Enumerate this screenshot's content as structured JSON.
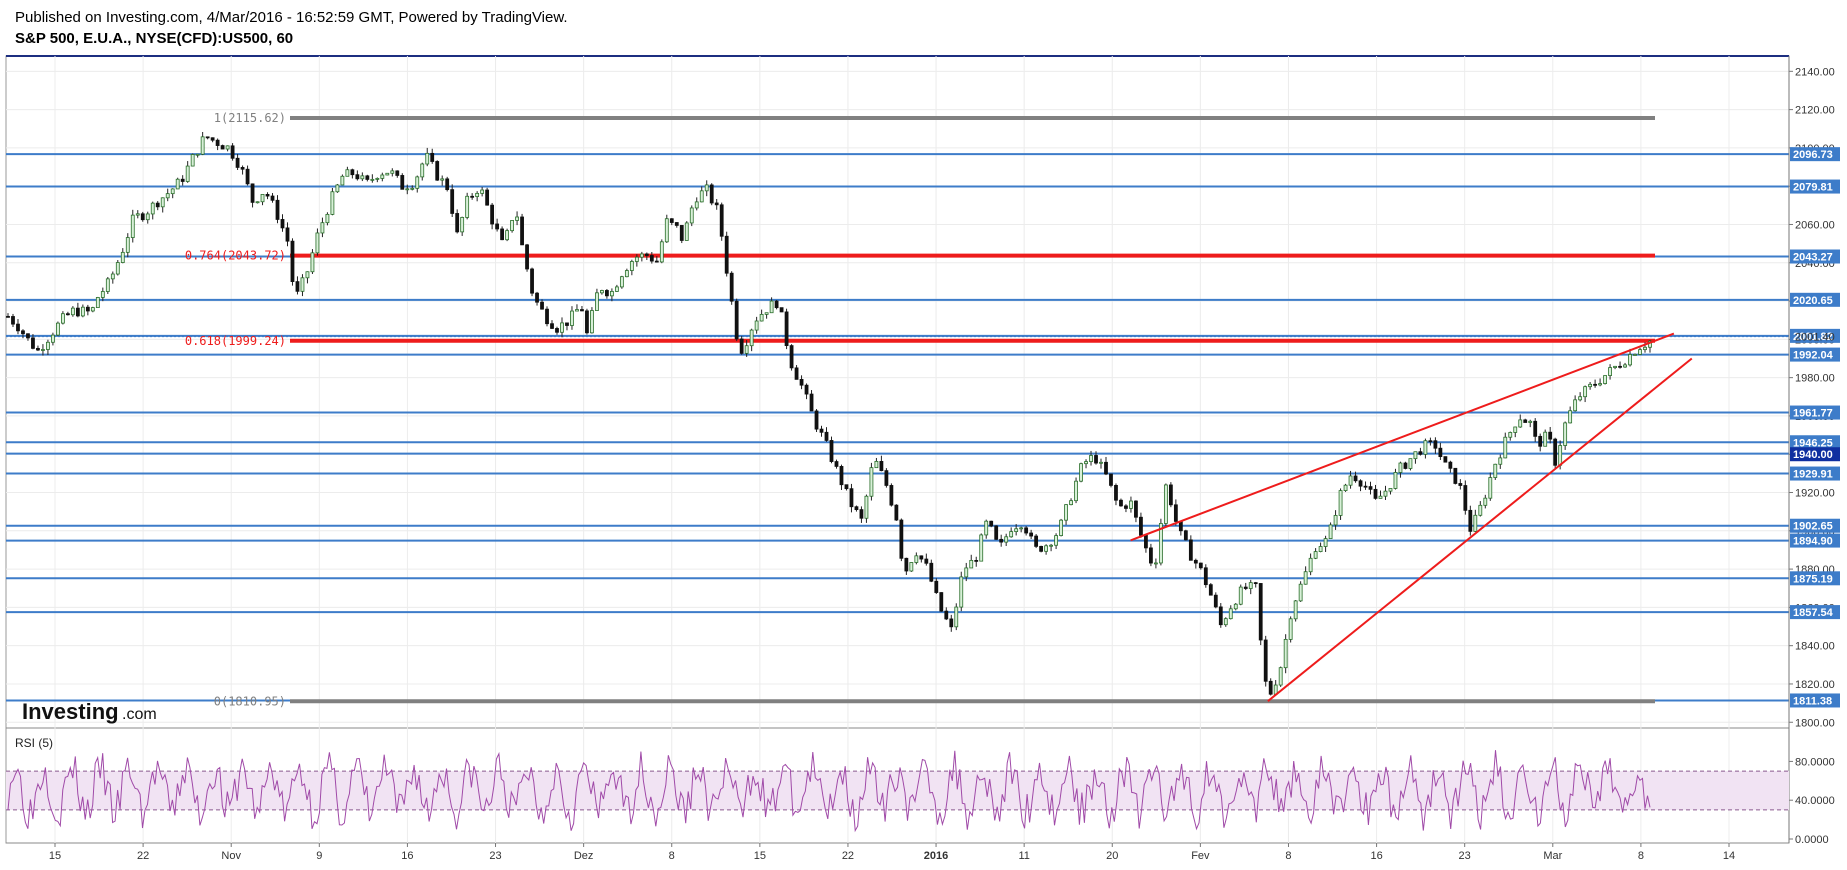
{
  "header": {
    "published": "Published on Investing.com, 4/Mar/2016 - 16:52:59 GMT, Powered by TradingView.",
    "symbol": "S&P 500, E.U.A., NYSE(CFD):US500, 60"
  },
  "logo": {
    "main": "Investing",
    "suffix": ".com"
  },
  "rsi_label": "RSI (5)",
  "chart_data": {
    "type": "candlestick",
    "price_axis": {
      "ylim": [
        1797,
        2148
      ],
      "ticks": [
        1800,
        1820,
        1840,
        1860,
        1880,
        1900,
        1920,
        1940,
        1960,
        1980,
        2000,
        2020,
        2040,
        2060,
        2080,
        2100,
        2120,
        2140
      ],
      "tick_labels": [
        "1800.00",
        "1820.00",
        "1840.00",
        "1860.00",
        "1880.00",
        "1900.00",
        "1920.00",
        "1940.00",
        "1960.00",
        "1980.00",
        "2000.00",
        "2020.00",
        "2040.00",
        "2060.00",
        "2080.00",
        "2100.00",
        "2120.00",
        "2140.00"
      ]
    },
    "x_axis": {
      "labels": [
        "15",
        "22",
        "Nov",
        "9",
        "16",
        "23",
        "Dez",
        "8",
        "15",
        "22",
        "2016",
        "11",
        "20",
        "Fev",
        "8",
        "16",
        "23",
        "Mar",
        "8",
        "14"
      ],
      "bold_labels": [
        "2016"
      ]
    },
    "horizontal_levels": [
      {
        "value": 2096.73,
        "label": "2096.73"
      },
      {
        "value": 2079.81,
        "label": "2079.81"
      },
      {
        "value": 2043.27,
        "label": "2043.27"
      },
      {
        "value": 2020.65,
        "label": "2020.65"
      },
      {
        "value": 2001.82,
        "label": "2001.82"
      },
      {
        "value": 1992.04,
        "label": "1992.04"
      },
      {
        "value": 1961.77,
        "label": "1961.77"
      },
      {
        "value": 1946.25,
        "label": "1946.25"
      },
      {
        "value": 1940.31,
        "label": "1940.31"
      },
      {
        "value": 1929.91,
        "label": "1929.91"
      },
      {
        "value": 1902.65,
        "label": "1902.65"
      },
      {
        "value": 1894.9,
        "label": "1894.90"
      },
      {
        "value": 1875.19,
        "label": "1875.19"
      },
      {
        "value": 1857.54,
        "label": "1857.54"
      },
      {
        "value": 1811.38,
        "label": "1811.38"
      }
    ],
    "current_price": {
      "value": 1940.0,
      "label": "1940.00"
    },
    "dotted_level": {
      "value": 2001.4,
      "label": "2001.40"
    },
    "fibonacci": [
      {
        "value": 2115.62,
        "label": "1(2115.62)",
        "color": "#808080"
      },
      {
        "value": 2043.72,
        "label": "0.764(2043.72)",
        "color": "#ee1c1c"
      },
      {
        "value": 1999.24,
        "label": "0.618(1999.24)",
        "color": "#ee1c1c"
      },
      {
        "value": 1810.95,
        "label": "0(1810.95)",
        "color": "#808080"
      }
    ],
    "price_path": [
      [
        0,
        2012
      ],
      [
        2,
        2006
      ],
      [
        3,
        2001
      ],
      [
        5,
        1994
      ],
      [
        7,
        2002
      ],
      [
        9,
        2010
      ],
      [
        11,
        2015
      ],
      [
        14,
        2014
      ],
      [
        15,
        2022
      ],
      [
        17,
        2030
      ],
      [
        19,
        2045
      ],
      [
        21,
        2063
      ],
      [
        23,
        2066
      ],
      [
        25,
        2072
      ],
      [
        27,
        2077
      ],
      [
        29,
        2083
      ],
      [
        31,
        2095
      ],
      [
        33,
        2106
      ],
      [
        35,
        2103
      ],
      [
        37,
        2100
      ],
      [
        39,
        2090
      ],
      [
        41,
        2072
      ],
      [
        43,
        2078
      ],
      [
        45,
        2066
      ],
      [
        47,
        2050
      ],
      [
        48,
        2020
      ],
      [
        50,
        2034
      ],
      [
        52,
        2056
      ],
      [
        54,
        2072
      ],
      [
        56,
        2085
      ],
      [
        58,
        2087
      ],
      [
        60,
        2081
      ],
      [
        62,
        2087
      ],
      [
        64,
        2088
      ],
      [
        66,
        2080
      ],
      [
        68,
        2082
      ],
      [
        70,
        2096
      ],
      [
        72,
        2085
      ],
      [
        74,
        2078
      ],
      [
        75,
        2052
      ],
      [
        77,
        2073
      ],
      [
        79,
        2080
      ],
      [
        81,
        2063
      ],
      [
        83,
        2048
      ],
      [
        85,
        2070
      ],
      [
        86,
        2050
      ],
      [
        88,
        2022
      ],
      [
        90,
        2012
      ],
      [
        92,
        2006
      ],
      [
        94,
        2010
      ],
      [
        96,
        2018
      ],
      [
        97,
        2002
      ],
      [
        99,
        2028
      ],
      [
        101,
        2024
      ],
      [
        103,
        2036
      ],
      [
        105,
        2043
      ],
      [
        107,
        2044
      ],
      [
        109,
        2040
      ],
      [
        110,
        2062
      ],
      [
        112,
        2058
      ],
      [
        113,
        2052
      ],
      [
        115,
        2074
      ],
      [
        117,
        2078
      ],
      [
        119,
        2066
      ],
      [
        120,
        2044
      ],
      [
        122,
        2003
      ],
      [
        123,
        1994
      ],
      [
        125,
        2010
      ],
      [
        127,
        2016
      ],
      [
        129,
        2020
      ],
      [
        131,
        1989
      ],
      [
        133,
        1975
      ],
      [
        135,
        1958
      ],
      [
        137,
        1945
      ],
      [
        139,
        1930
      ],
      [
        141,
        1915
      ],
      [
        143,
        1905
      ],
      [
        145,
        1938
      ],
      [
        147,
        1925
      ],
      [
        149,
        1905
      ],
      [
        150,
        1877
      ],
      [
        152,
        1890
      ],
      [
        154,
        1880
      ],
      [
        156,
        1860
      ],
      [
        158,
        1848
      ],
      [
        160,
        1880
      ],
      [
        162,
        1885
      ],
      [
        164,
        1905
      ],
      [
        166,
        1890
      ],
      [
        168,
        1902
      ],
      [
        170,
        1905
      ],
      [
        172,
        1890
      ],
      [
        174,
        1893
      ],
      [
        176,
        1900
      ],
      [
        178,
        1918
      ],
      [
        180,
        1935
      ],
      [
        182,
        1939
      ],
      [
        184,
        1928
      ],
      [
        186,
        1912
      ],
      [
        188,
        1915
      ],
      [
        190,
        1895
      ],
      [
        192,
        1880
      ],
      [
        194,
        1925
      ],
      [
        196,
        1900
      ],
      [
        198,
        1888
      ],
      [
        200,
        1878
      ],
      [
        202,
        1862
      ],
      [
        203,
        1850
      ],
      [
        205,
        1862
      ],
      [
        207,
        1870
      ],
      [
        209,
        1870
      ],
      [
        210,
        1835
      ],
      [
        211,
        1812
      ],
      [
        213,
        1827
      ],
      [
        215,
        1860
      ],
      [
        217,
        1875
      ],
      [
        219,
        1892
      ],
      [
        221,
        1895
      ],
      [
        223,
        1918
      ],
      [
        225,
        1930
      ],
      [
        227,
        1925
      ],
      [
        229,
        1915
      ],
      [
        231,
        1922
      ],
      [
        233,
        1932
      ],
      [
        235,
        1938
      ],
      [
        237,
        1944
      ],
      [
        239,
        1945
      ],
      [
        241,
        1932
      ],
      [
        243,
        1925
      ],
      [
        245,
        1900
      ],
      [
        247,
        1915
      ],
      [
        249,
        1935
      ],
      [
        251,
        1948
      ],
      [
        253,
        1960
      ],
      [
        255,
        1956
      ],
      [
        256,
        1945
      ],
      [
        258,
        1950
      ],
      [
        259,
        1935
      ],
      [
        261,
        1958
      ],
      [
        263,
        1970
      ],
      [
        265,
        1975
      ],
      [
        267,
        1980
      ],
      [
        269,
        1985
      ],
      [
        271,
        1990
      ],
      [
        273,
        1996
      ],
      [
        275,
        1999
      ]
    ],
    "rsi": {
      "label": "RSI (5)",
      "ylim": [
        0,
        100
      ],
      "ticks": [
        0,
        40,
        80
      ],
      "tick_labels": [
        "0.0000",
        "40.0000",
        "80.0000"
      ],
      "band": [
        30,
        70
      ]
    }
  }
}
